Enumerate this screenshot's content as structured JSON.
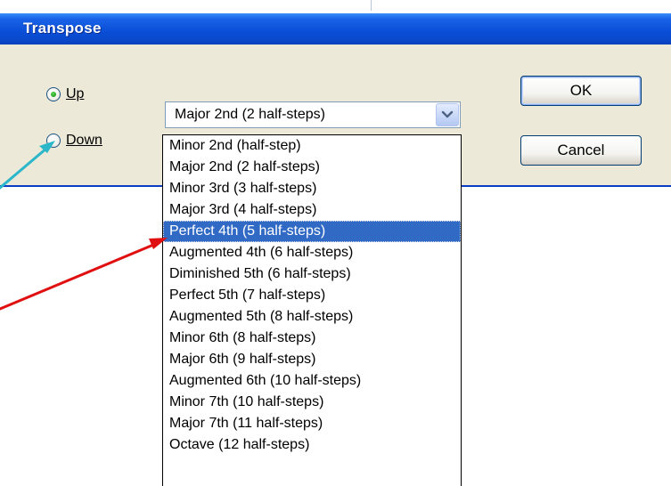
{
  "dialog": {
    "title": "Transpose"
  },
  "direction": {
    "up_label": "Up",
    "down_label": "Down",
    "selected": "up"
  },
  "buttons": {
    "ok_label": "OK",
    "cancel_label": "Cancel"
  },
  "interval_combo": {
    "value": "Major 2nd (2 half-steps)"
  },
  "interval_list": {
    "highlighted": "Perfect 4th (5 half-steps)",
    "items": [
      "Minor 2nd (half-step)",
      "Major 2nd (2 half-steps)",
      "Minor 3rd (3 half-steps)",
      "Major 3rd (4 half-steps)",
      "Perfect 4th (5 half-steps)",
      "Augmented 4th (6 half-steps)",
      "Diminished 5th (6 half-steps)",
      "Perfect 5th (7 half-steps)",
      "Augmented 5th (8 half-steps)",
      "Minor 6th (8 half-steps)",
      "Major 6th (9 half-steps)",
      "Augmented 6th (10 half-steps)",
      "Minor 7th (10 half-steps)",
      "Major 7th (11 half-steps)",
      "Octave (12 half-steps)"
    ]
  },
  "annotations": {
    "teal_arrow_color": "#2bb7c9",
    "red_arrow_color": "#e01010"
  }
}
